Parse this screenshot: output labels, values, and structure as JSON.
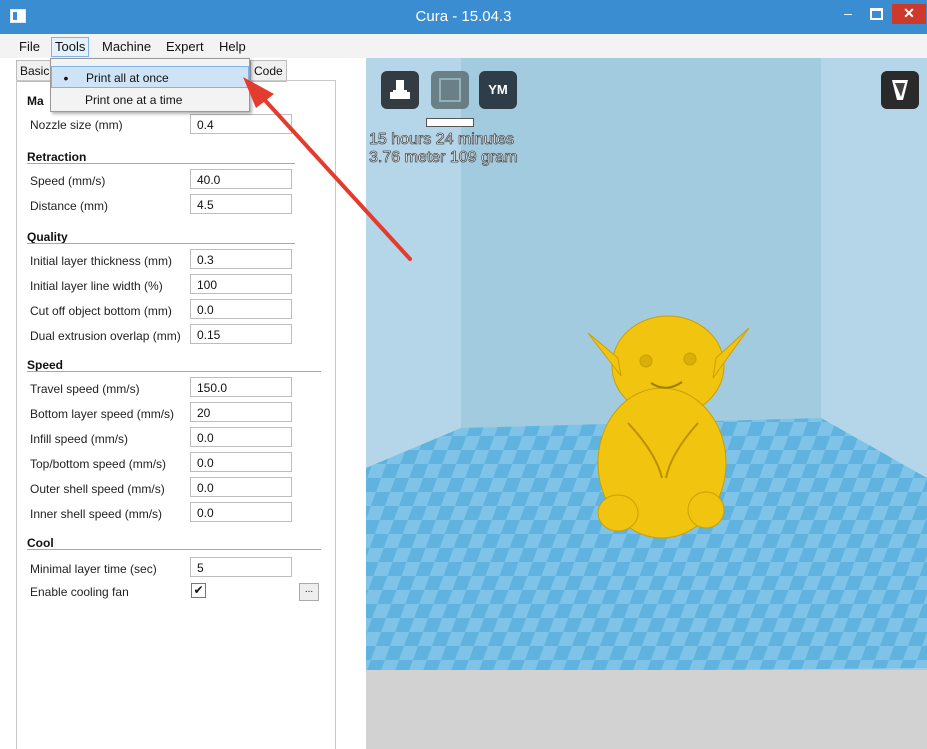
{
  "window": {
    "title": "Cura - 15.04.3"
  },
  "menu": {
    "items": [
      {
        "label": "File"
      },
      {
        "label": "Tools"
      },
      {
        "label": "Machine"
      },
      {
        "label": "Expert"
      },
      {
        "label": "Help"
      }
    ]
  },
  "tabs": {
    "basic": "Basic",
    "code": "Code"
  },
  "dropdown": {
    "items": [
      {
        "label": "Print all at once",
        "selected": true,
        "bullet": "•"
      },
      {
        "label": "Print one at a time",
        "selected": false,
        "bullet": ""
      }
    ]
  },
  "sections": {
    "machine": "Ma",
    "retraction": "Retraction",
    "quality": "Quality",
    "speed": "Speed",
    "cool": "Cool"
  },
  "settings": {
    "nozzle_size": {
      "label": "Nozzle size (mm)",
      "value": "0.4"
    },
    "retraction_speed": {
      "label": "Speed (mm/s)",
      "value": "40.0"
    },
    "retraction_distance": {
      "label": "Distance (mm)",
      "value": "4.5"
    },
    "initial_layer_thickness": {
      "label": "Initial layer thickness (mm)",
      "value": "0.3"
    },
    "initial_layer_width": {
      "label": "Initial layer line width (%)",
      "value": "100"
    },
    "cut_off_bottom": {
      "label": "Cut off object bottom (mm)",
      "value": "0.0"
    },
    "dual_overlap": {
      "label": "Dual extrusion overlap (mm)",
      "value": "0.15"
    },
    "travel_speed": {
      "label": "Travel speed (mm/s)",
      "value": "150.0"
    },
    "bottom_layer_speed": {
      "label": "Bottom layer speed (mm/s)",
      "value": "20"
    },
    "infill_speed": {
      "label": "Infill speed (mm/s)",
      "value": "0.0"
    },
    "top_bottom_speed": {
      "label": "Top/bottom speed (mm/s)",
      "value": "0.0"
    },
    "outer_shell_speed": {
      "label": "Outer shell speed (mm/s)",
      "value": "0.0"
    },
    "inner_shell_speed": {
      "label": "Inner shell speed (mm/s)",
      "value": "0.0"
    },
    "minimal_layer_time": {
      "label": "Minimal layer time (sec)",
      "value": "5"
    },
    "cooling_fan": {
      "label": "Enable cooling fan",
      "checked": true,
      "check_glyph": "✔",
      "more_label": "..."
    }
  },
  "viewport": {
    "ym_label": "YM",
    "print_time": "15 hours 24 minutes",
    "print_material": "3.76 meter 109 gram",
    "model_color": "#f1c40f",
    "bed_color": "#5fb3de"
  }
}
